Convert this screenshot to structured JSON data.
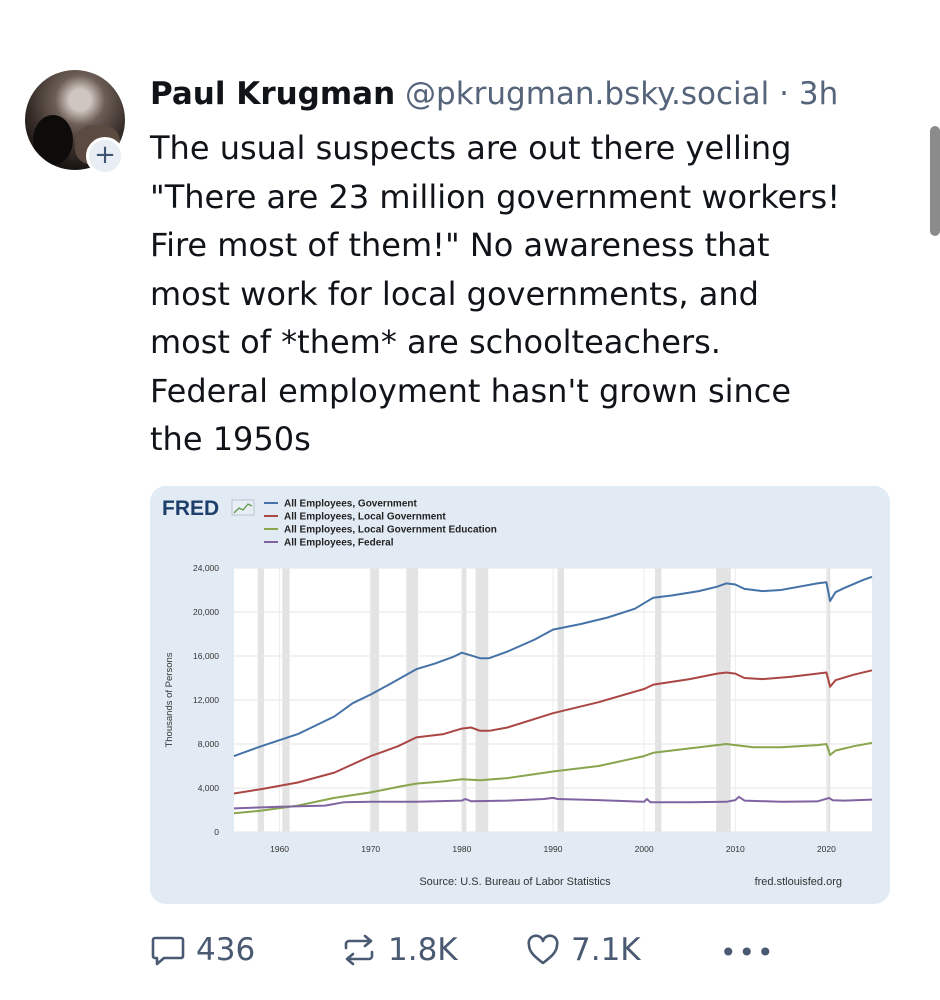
{
  "post": {
    "author_name": "Paul Krugman",
    "author_handle": "@pkrugman.bsky.social",
    "separator": "·",
    "time_ago": "3h",
    "follow_symbol": "+",
    "text": "The usual suspects are out there yelling\n\"There are 23 million government workers!\nFire most of them!\" No awareness that\nmost work for local governments, and\nmost of *them* are schoolteachers.\nFederal employment hasn't grown since\nthe 1950s"
  },
  "chart_data": {
    "type": "line",
    "logo": "FRED",
    "ylabel": "Thousands of Persons",
    "xlabel": "",
    "xlim": [
      1955,
      2025
    ],
    "ylim": [
      0,
      24000
    ],
    "x_ticks": [
      1960,
      1970,
      1980,
      1990,
      2000,
      2010,
      2020
    ],
    "y_ticks": [
      0,
      4000,
      8000,
      12000,
      16000,
      20000,
      24000
    ],
    "y_tick_labels": [
      "0",
      "4,000",
      "8,000",
      "12,000",
      "16,000",
      "20,000",
      "24,000"
    ],
    "source": "Source: U.S. Bureau of Labor Statistics",
    "site": "fred.stlouisfed.org",
    "grid": true,
    "legend_position": "top-left",
    "recessions": [
      [
        1957.6,
        1958.3
      ],
      [
        1960.3,
        1961.1
      ],
      [
        1969.9,
        1970.9
      ],
      [
        1973.9,
        1975.2
      ],
      [
        1980.0,
        1980.5
      ],
      [
        1981.5,
        1982.9
      ],
      [
        1990.5,
        1991.2
      ],
      [
        2001.2,
        2001.9
      ],
      [
        2007.9,
        2009.5
      ],
      [
        2020.1,
        2020.4
      ]
    ],
    "series": [
      {
        "name": "All Employees, Government",
        "color": "#4572a7",
        "points": [
          [
            1955,
            6900
          ],
          [
            1958,
            7800
          ],
          [
            1962,
            8900
          ],
          [
            1966,
            10500
          ],
          [
            1968,
            11700
          ],
          [
            1970,
            12500
          ],
          [
            1972,
            13400
          ],
          [
            1975,
            14800
          ],
          [
            1977,
            15300
          ],
          [
            1979,
            15900
          ],
          [
            1980,
            16300
          ],
          [
            1982,
            15800
          ],
          [
            1983,
            15800
          ],
          [
            1985,
            16400
          ],
          [
            1988,
            17500
          ],
          [
            1990,
            18400
          ],
          [
            1993,
            18900
          ],
          [
            1996,
            19500
          ],
          [
            1999,
            20300
          ],
          [
            2000,
            20800
          ],
          [
            2001,
            21300
          ],
          [
            2003,
            21500
          ],
          [
            2006,
            21900
          ],
          [
            2008,
            22300
          ],
          [
            2009,
            22600
          ],
          [
            2010,
            22500
          ],
          [
            2011,
            22100
          ],
          [
            2013,
            21900
          ],
          [
            2015,
            22000
          ],
          [
            2017,
            22300
          ],
          [
            2019,
            22600
          ],
          [
            2020,
            22700
          ],
          [
            2020.4,
            21000
          ],
          [
            2021,
            21800
          ],
          [
            2022,
            22200
          ],
          [
            2024,
            22900
          ],
          [
            2025,
            23200
          ]
        ]
      },
      {
        "name": "All Employees, Local Government",
        "color": "#aa4643",
        "points": [
          [
            1955,
            3500
          ],
          [
            1958,
            3900
          ],
          [
            1962,
            4500
          ],
          [
            1966,
            5400
          ],
          [
            1970,
            6900
          ],
          [
            1973,
            7800
          ],
          [
            1975,
            8600
          ],
          [
            1978,
            8900
          ],
          [
            1980,
            9400
          ],
          [
            1981,
            9500
          ],
          [
            1982,
            9200
          ],
          [
            1983,
            9200
          ],
          [
            1985,
            9500
          ],
          [
            1990,
            10800
          ],
          [
            1995,
            11800
          ],
          [
            2000,
            13000
          ],
          [
            2001,
            13400
          ],
          [
            2005,
            13900
          ],
          [
            2008,
            14400
          ],
          [
            2009,
            14500
          ],
          [
            2010,
            14400
          ],
          [
            2011,
            14000
          ],
          [
            2013,
            13900
          ],
          [
            2016,
            14100
          ],
          [
            2019,
            14400
          ],
          [
            2020,
            14500
          ],
          [
            2020.4,
            13200
          ],
          [
            2021,
            13800
          ],
          [
            2023,
            14300
          ],
          [
            2025,
            14700
          ]
        ]
      },
      {
        "name": "All Employees, Local Government Education",
        "color": "#89a54e",
        "points": [
          [
            1955,
            1700
          ],
          [
            1958,
            1950
          ],
          [
            1962,
            2400
          ],
          [
            1966,
            3100
          ],
          [
            1970,
            3600
          ],
          [
            1973,
            4100
          ],
          [
            1975,
            4400
          ],
          [
            1978,
            4600
          ],
          [
            1980,
            4800
          ],
          [
            1982,
            4700
          ],
          [
            1985,
            4900
          ],
          [
            1990,
            5500
          ],
          [
            1995,
            6000
          ],
          [
            2000,
            6900
          ],
          [
            2001,
            7200
          ],
          [
            2005,
            7600
          ],
          [
            2008,
            7900
          ],
          [
            2009,
            8000
          ],
          [
            2010,
            7900
          ],
          [
            2012,
            7700
          ],
          [
            2015,
            7700
          ],
          [
            2019,
            7900
          ],
          [
            2020,
            8000
          ],
          [
            2020.4,
            7000
          ],
          [
            2021,
            7400
          ],
          [
            2023,
            7800
          ],
          [
            2025,
            8100
          ]
        ]
      },
      {
        "name": "All Employees, Federal",
        "color": "#8064a2",
        "points": [
          [
            1955,
            2150
          ],
          [
            1960,
            2300
          ],
          [
            1965,
            2400
          ],
          [
            1967,
            2700
          ],
          [
            1970,
            2750
          ],
          [
            1975,
            2750
          ],
          [
            1980,
            2850
          ],
          [
            1980.4,
            3000
          ],
          [
            1981,
            2800
          ],
          [
            1985,
            2850
          ],
          [
            1989,
            3000
          ],
          [
            1990,
            3100
          ],
          [
            1990.5,
            3000
          ],
          [
            1995,
            2900
          ],
          [
            2000,
            2750
          ],
          [
            2000.3,
            3000
          ],
          [
            2000.7,
            2700
          ],
          [
            2005,
            2700
          ],
          [
            2009,
            2750
          ],
          [
            2010,
            2900
          ],
          [
            2010.4,
            3200
          ],
          [
            2011,
            2850
          ],
          [
            2015,
            2750
          ],
          [
            2019,
            2780
          ],
          [
            2020.3,
            3100
          ],
          [
            2020.7,
            2880
          ],
          [
            2022,
            2850
          ],
          [
            2025,
            2950
          ]
        ]
      }
    ]
  },
  "actions": {
    "replies": "436",
    "reposts": "1.8K",
    "likes": "7.1K",
    "more": "•••"
  },
  "colors": {
    "handle": "#55647a",
    "action": "#4a5a72",
    "card_bg": "#e2ebf4"
  }
}
